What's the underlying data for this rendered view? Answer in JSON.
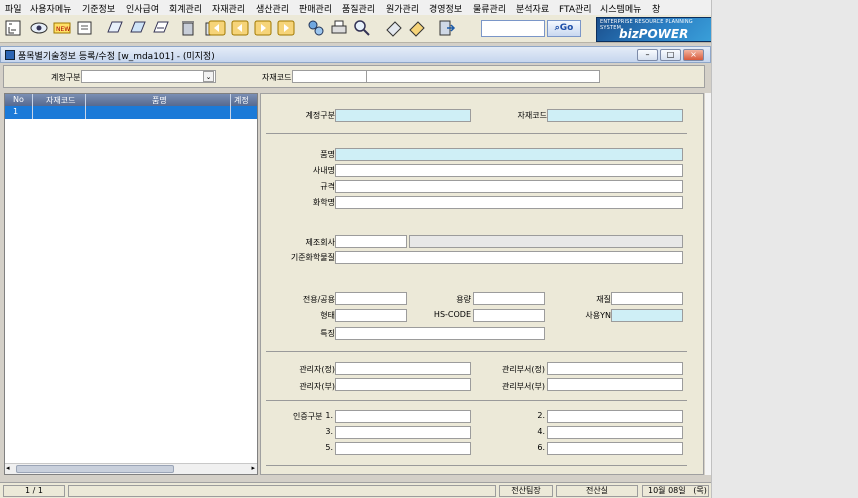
{
  "menu": [
    "파일",
    "사용자메뉴",
    "기준정보",
    "인사급여",
    "회계관리",
    "자재관리",
    "생산관리",
    "판매관리",
    "품질관리",
    "원가관리",
    "경영정보",
    "물류관리",
    "분석자료",
    "FTA관리",
    "시스템메뉴",
    "창"
  ],
  "search": {
    "go_label": "Go",
    "value": ""
  },
  "brand": {
    "tagline": "ENTERPRISE RESOURCE PLANNING SYSTEM",
    "name": "bizPOWER ERP"
  },
  "window": {
    "title": "품목별기술정보 등록/수정 [w_mda101] - (미지정)"
  },
  "filter": {
    "account_label": "계정구분",
    "account_value": "",
    "material_code_label": "자재코드",
    "material_code_value": "",
    "material_name_value": ""
  },
  "grid": {
    "columns": [
      "No",
      "자재코드",
      "품명",
      "계정"
    ],
    "rows": [
      {
        "no": "1",
        "code": "",
        "name": "",
        "account": ""
      }
    ]
  },
  "detail": {
    "account_label": "계정구분",
    "material_code_label": "자재코드",
    "item_name_label": "품명",
    "internal_name_label": "사내명",
    "spec_label": "규격",
    "chemical_name_label": "화학명",
    "manufacturer_label": "제조회사",
    "base_chemical_label": "기준화학물질",
    "usage_label": "전용/공용",
    "capacity_label": "용량",
    "material_label": "재질",
    "shape_label": "형태",
    "hscode_label": "HS-CODE",
    "use_yn_label": "사용YN",
    "feature_label": "특징",
    "manager_main_label": "관리자(정)",
    "manager_dept_main_label": "관리부서(정)",
    "manager_sub_label": "관리자(부)",
    "manager_dept_sub_label": "관리부서(부)",
    "cert_label": "인증구분",
    "cert_numbers": [
      "1.",
      "2.",
      "3.",
      "4.",
      "5.",
      "6."
    ]
  },
  "status": {
    "page": "1 / 1",
    "dept1": "전산팀장",
    "dept2": "전산실",
    "date": "10월 08일",
    "weekday": "(목)"
  },
  "colors": {
    "grid_selected": "#1b7ad8",
    "readonly_field": "#cfeff6",
    "banner": "#1b4f8c"
  }
}
